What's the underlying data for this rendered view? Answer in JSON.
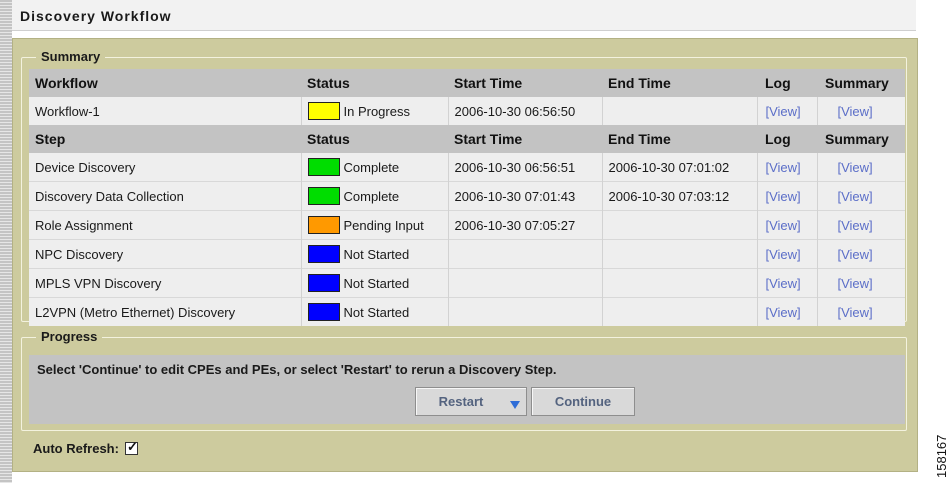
{
  "title": "Discovery Workflow",
  "summary": {
    "legend": "Summary",
    "workflow_header": [
      "Workflow",
      "Status",
      "Start Time",
      "End Time",
      "Log",
      "Summary"
    ],
    "workflow_row": {
      "name": "Workflow-1",
      "status": "In Progress",
      "status_color": "#ffff00",
      "start": "2006-10-30 06:56:50",
      "end": "",
      "log": "[View]",
      "summary": "[View]"
    },
    "step_header": [
      "Step",
      "Status",
      "Start Time",
      "End Time",
      "Log",
      "Summary"
    ],
    "steps": [
      {
        "name": "Device Discovery",
        "status": "Complete",
        "status_color": "#00dd00",
        "start": "2006-10-30 06:56:51",
        "end": "2006-10-30 07:01:02",
        "log": "[View]",
        "summary": "[View]"
      },
      {
        "name": "Discovery Data Collection",
        "status": "Complete",
        "status_color": "#00dd00",
        "start": "2006-10-30 07:01:43",
        "end": "2006-10-30 07:03:12",
        "log": "[View]",
        "summary": "[View]"
      },
      {
        "name": "Role Assignment",
        "status": "Pending Input",
        "status_color": "#ff9900",
        "start": "2006-10-30 07:05:27",
        "end": "",
        "log": "[View]",
        "summary": "[View]"
      },
      {
        "name": "NPC Discovery",
        "status": "Not Started",
        "status_color": "#0000ff",
        "start": "",
        "end": "",
        "log": "[View]",
        "summary": "[View]"
      },
      {
        "name": "MPLS VPN Discovery",
        "status": "Not Started",
        "status_color": "#0000ff",
        "start": "",
        "end": "",
        "log": "[View]",
        "summary": "[View]"
      },
      {
        "name": "L2VPN (Metro Ethernet) Discovery",
        "status": "Not Started",
        "status_color": "#0000ff",
        "start": "",
        "end": "",
        "log": "[View]",
        "summary": "[View]"
      }
    ]
  },
  "progress": {
    "legend": "Progress",
    "message": "Select 'Continue' to edit CPEs and PEs, or select 'Restart' to rerun a Discovery Step.",
    "restart_label": "Restart",
    "continue_label": "Continue"
  },
  "auto_refresh": {
    "label": "Auto Refresh:",
    "checked": true,
    "check_glyph": "✓"
  },
  "figure_id": "158167",
  "colors": {
    "panel_bg": "#cdcb9e",
    "header_bg": "#c3c3c3",
    "row_bg": "#eeeeee",
    "link": "#5b6ec8"
  }
}
